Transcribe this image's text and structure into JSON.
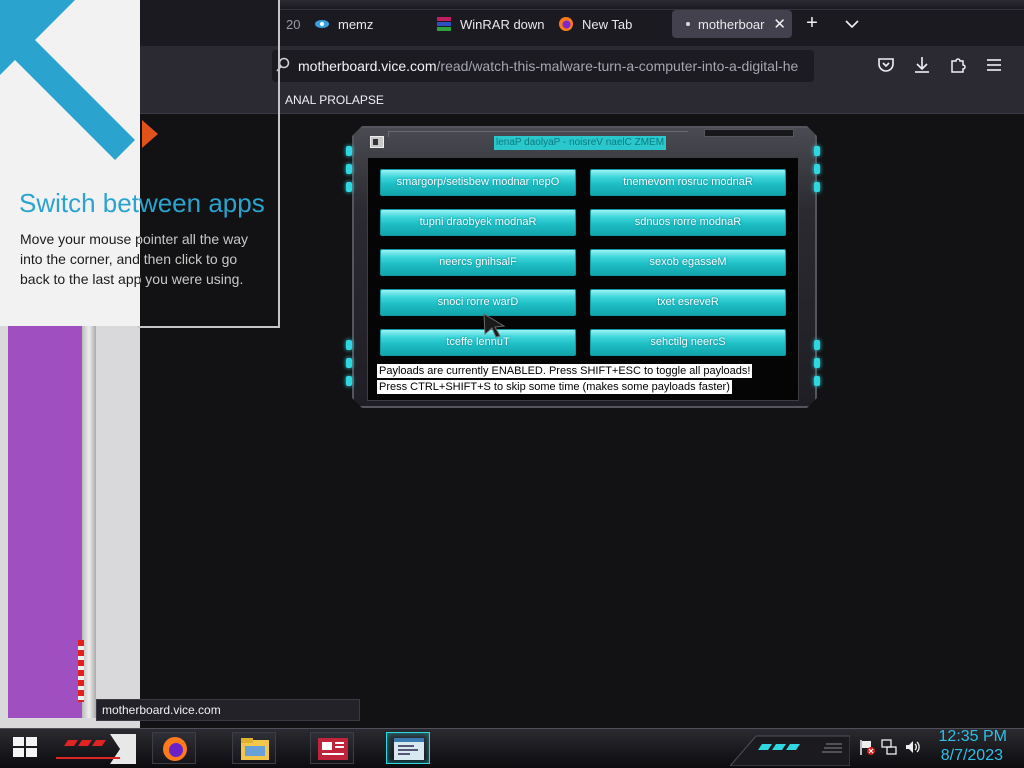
{
  "browser": {
    "tabs": [
      {
        "label": "20-",
        "icon": "partial-tab-icon"
      },
      {
        "label": "memz",
        "icon": "memz-favicon"
      },
      {
        "label": "WinRAR down",
        "icon": "winrar-favicon"
      },
      {
        "label": "New Tab",
        "icon": "firefox-icon"
      },
      {
        "label": "motherboar",
        "icon": "none",
        "active": true
      }
    ],
    "url_domain": "motherboard.vice.com",
    "url_path": "/read/watch-this-malware-turn-a-computer-into-a-digital-he",
    "bookmark": "ANAL PROLAPSE",
    "status_url": "motherboard.vice.com"
  },
  "memz": {
    "title": "lenaP daolyaP - noisreV naelC ZMEM",
    "buttons_left": [
      "smargorp/setisbew modnar nepO",
      "tupni draobyek modnaR",
      "neercs gnihsalF",
      "snoci rorre warD",
      "tceffe lennuT"
    ],
    "buttons_right": [
      "tnemevom rosruc modnaR",
      "sdnuos rorre modnaR",
      "sexob egasseM",
      "txet esreveR",
      "sehctilg neercS"
    ],
    "status_enabled": "Payloads are currently ENABLED. Press SHIFT+ESC to toggle all payloads!",
    "status_skip": "Press CTRL+SHIFT+S to skip some time (makes some payloads faster)"
  },
  "tip": {
    "title": "Switch between apps",
    "description": "Move your mouse pointer all the way into the corner, and then click to go back to the last app you were using."
  },
  "taskbar": {
    "time": "12:35 PM",
    "date": "8/7/2023"
  },
  "colors": {
    "accent_cyan": "#2fd8e0",
    "tip_title": "#2aa4cf",
    "purple_window": "#a04fc0",
    "browser_bg": "#1b1a21"
  }
}
